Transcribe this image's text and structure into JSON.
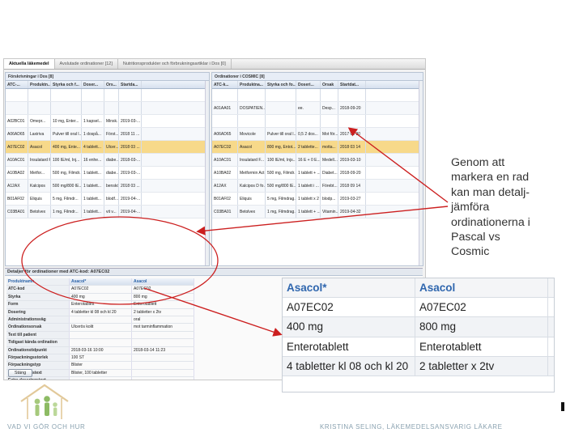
{
  "tabs": [
    "Aktuella läkemedel",
    "Avslutade ordinationer [12]",
    "Nutritionsprodukter och förbrukningsartiklar i Dos [0]"
  ],
  "left_grid": {
    "caption": "Förskrivningar i Dos [8]",
    "columns": [
      "ATC-...",
      "Produktn...",
      "Styrka och f...",
      "Doser...",
      "Ors...",
      "Startda..."
    ],
    "rows": [
      [
        "",
        "",
        "",
        "",
        "",
        ""
      ],
      [
        "",
        "",
        "",
        "",
        "",
        ""
      ],
      [
        "A02BC01",
        "Omepr...",
        "10 mg, Enter...",
        "1 kapsel...",
        "Minsk...",
        "2019-03-..."
      ],
      [
        "A06AD65",
        "Laxiriva",
        "Pulver till oral l...",
        "1 dospå...",
        "Först...",
        "2018 11 ..."
      ],
      [
        "A07EC02",
        "Asacol",
        "400 mg, Ente...",
        "4 tablett...",
        "Ulcer...",
        "2018 03 ..."
      ],
      [
        "A10AC01",
        "Insulatard F...",
        "100 IE/ml, Inj...",
        "16 enhe...",
        "diabe...",
        "2018-03-..."
      ],
      [
        "A10BA02",
        "Metfor...",
        "500 mg, Filmdr...",
        "1 tablett...",
        "diabe...",
        "2019-03-..."
      ],
      [
        "A12AX",
        "Kalcipos",
        "500 mg/800 IE...",
        "1 tablett...",
        "benskör...",
        "2018 03 ..."
      ],
      [
        "B01AF02",
        "Eliquis",
        "5 mg, Filmdr...",
        "1 tablett...",
        "blodf...",
        "2019-04-..."
      ],
      [
        "C03BA01",
        "Betolvex",
        "1 mg, Filmdr...",
        "1 tablett...",
        "vit v...",
        "2019-04-..."
      ]
    ],
    "selected_row": 4
  },
  "right_grid": {
    "caption": "Ordinationer i COSMIC [8]",
    "columns": [
      "ATC-k...",
      "Produktna...",
      "Styrka och fo...",
      "Doseri...",
      "Orsak",
      "Startdat..."
    ],
    "rows": [
      [
        "",
        "",
        "",
        "",
        "",
        ""
      ],
      [
        "A01AA01",
        "DOSPATIEN...",
        "",
        "ee.",
        "Desp...",
        "2018-09-20"
      ],
      [
        "",
        "",
        "",
        "",
        "",
        ""
      ],
      [
        "A06AD65",
        "Movicole",
        "Pulver till oral l...",
        "0,5 2 dos...",
        "Mot för...",
        "2017 05 30"
      ],
      [
        "A07EC02",
        "Asacol",
        "800 mg, Entot...",
        "2 tablette...",
        "motta...",
        "2018 03 14"
      ],
      [
        "A10AC01",
        "Insulatard F...",
        "100 IE/ml, Injs...",
        "16 E + 0 E...",
        "Medell...",
        "2019-03-10"
      ],
      [
        "A10BA02",
        "Metformin Act...",
        "500 mg, Filmdr...",
        "1 tablett + ...",
        "Diabet...",
        "2018-09-20"
      ],
      [
        "A12AX",
        "Kalcipos D fo...",
        "500 mg/800 IE...",
        "1 tablett i ...",
        "Förebt...",
        "2018 09 14"
      ],
      [
        "B01AF02",
        "Eliquis",
        "5 mg, Filmdrag...",
        "1 tablett x 2",
        "blodp...",
        "2019-03-27"
      ],
      [
        "C03BA01",
        "Betolvex",
        "1 mg, Filmdrag...",
        "1 tablett + ...",
        "Vitamin...",
        "2019-04-32"
      ]
    ],
    "selected_row": 4
  },
  "detail": {
    "caption": "Detaljer för ordinationer med ATC-kod: A07EC02",
    "header": [
      "Produktnamn",
      "Asacol*",
      "Asacol"
    ],
    "rows": [
      [
        "ATC-kod",
        "A07EC02",
        "A07EC02"
      ],
      [
        "Styrka",
        "400 mg",
        "800 mg"
      ],
      [
        "Form",
        "Enterotablett",
        "Enterotablett"
      ],
      [
        "Dosering",
        "4 tabletter kl 08 och kl 20",
        "2 tabletter x 2tv"
      ],
      [
        "Administrationsväg",
        "",
        "oral"
      ],
      [
        "Ordinationsorsak",
        "Ulcerös kolit",
        "mot tarminflammation"
      ],
      [
        "Text till patient",
        "",
        ""
      ],
      [
        "Tidigast kända ordination",
        "",
        ""
      ],
      [
        "Ordinationstidpunkt",
        "2018-03-16 10:00",
        "2018-03-14 11:23"
      ],
      [
        "Förpackningsstorlek",
        "100 ST",
        ""
      ],
      [
        "Förpackningstyp",
        "Blister",
        ""
      ],
      [
        "Förpackningstext",
        "Blister, 100 tabletter",
        ""
      ],
      [
        "Extra doseringstext",
        "",
        ""
      ]
    ],
    "close_label": "Stäng"
  },
  "zoom_table": {
    "header": [
      "Asacol*",
      "Asacol"
    ],
    "rows": [
      [
        "A07EC02",
        "A07EC02"
      ],
      [
        "400 mg",
        "800 mg"
      ],
      [
        "Enterotablett",
        "Enterotablett"
      ],
      [
        "4 tabletter kl 08 och kl 20",
        "2 tabletter x 2tv"
      ]
    ]
  },
  "annotation": "Genom att\nmarkera en rad\nkan man detalj-\njämföra\nordinationerna i\nPascal vs\nCosmic",
  "footer": {
    "left": "VAD VI GÖR OCH HUR",
    "center": "KRISTINA SELING, LÄKEMEDELSANSVARIG LÄKARE"
  },
  "colors": {
    "selection": "#f7d98a",
    "arrow": "#cc1f1f",
    "column_header_blue": "#2f66ae"
  }
}
